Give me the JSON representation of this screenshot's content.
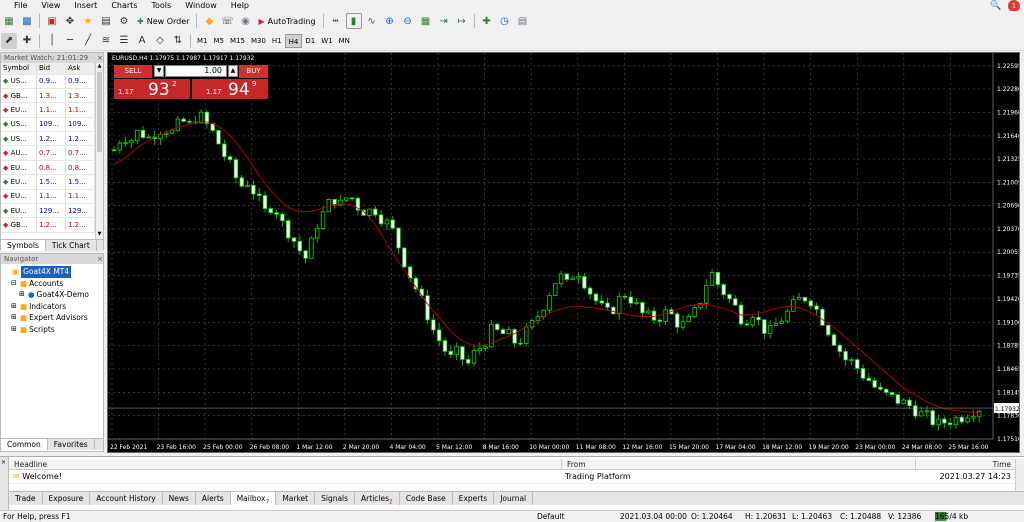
{
  "menu": [
    "File",
    "View",
    "Insert",
    "Charts",
    "Tools",
    "Window",
    "Help"
  ],
  "toolbar": {
    "new_order": "New Order",
    "autotrading": "AutoTrading",
    "timeframes": [
      "M1",
      "M5",
      "M15",
      "M30",
      "H1",
      "H4",
      "D1",
      "W1",
      "MN"
    ],
    "active_tf": "H4",
    "text_tool": "A",
    "notif_count": "1"
  },
  "market_watch": {
    "title": "Market Watch: 21:01:29",
    "cols": [
      "Symbol",
      "Bid",
      "Ask"
    ],
    "rows": [
      {
        "sym": "US...",
        "bid": "0.9...",
        "ask": "0.9...",
        "color": "#0000cc",
        "up": true
      },
      {
        "sym": "GB...",
        "bid": "1.3...",
        "ask": "1.3...",
        "color": "#cc0000",
        "up": false
      },
      {
        "sym": "EU...",
        "bid": "1.1...",
        "ask": "1.1...",
        "color": "#cc0000",
        "up": false
      },
      {
        "sym": "US...",
        "bid": "109...",
        "ask": "109...",
        "color": "#0000cc",
        "up": true
      },
      {
        "sym": "US...",
        "bid": "1.2...",
        "ask": "1.2...",
        "color": "#0000cc",
        "up": true
      },
      {
        "sym": "AU...",
        "bid": "0.7...",
        "ask": "0.7...",
        "color": "#cc0000",
        "up": false
      },
      {
        "sym": "EU...",
        "bid": "0.8...",
        "ask": "0.8...",
        "color": "#cc0000",
        "up": false
      },
      {
        "sym": "EU...",
        "bid": "1.5...",
        "ask": "1.5...",
        "color": "#0000cc",
        "up": true
      },
      {
        "sym": "EU...",
        "bid": "1.1...",
        "ask": "1.1...",
        "color": "#cc0000",
        "up": false
      },
      {
        "sym": "EU...",
        "bid": "129...",
        "ask": "129...",
        "color": "#0000cc",
        "up": true
      },
      {
        "sym": "GB...",
        "bid": "1.2...",
        "ask": "1.2...",
        "color": "#cc0000",
        "up": false
      }
    ],
    "tabs": [
      "Symbols",
      "Tick Chart"
    ]
  },
  "navigator": {
    "title": "Navigator",
    "items": [
      {
        "label": "Goat4X MT4",
        "indent": 0,
        "selected": true,
        "exp": ""
      },
      {
        "label": "Accounts",
        "indent": 1,
        "selected": false,
        "exp": "⊟"
      },
      {
        "label": "Goat4X-Demo",
        "indent": 2,
        "selected": false,
        "exp": "⊞"
      },
      {
        "label": "Indicators",
        "indent": 1,
        "selected": false,
        "exp": "⊞"
      },
      {
        "label": "Expert Advisors",
        "indent": 1,
        "selected": false,
        "exp": "⊞"
      },
      {
        "label": "Scripts",
        "indent": 1,
        "selected": false,
        "exp": "⊞"
      }
    ],
    "tabs": [
      "Common",
      "Favorites"
    ]
  },
  "chart": {
    "header": "EURUSD,H4  1.17975 1.17987 1.17917 1.17932",
    "sell_label": "SELL",
    "buy_label": "BUY",
    "lot": "1.00",
    "sell_prefix": "1.17",
    "sell_big": "93",
    "sell_sup": "2",
    "buy_prefix": "1.17",
    "buy_big": "94",
    "buy_sup": "9",
    "current_price": "1.17932"
  },
  "chart_data": {
    "type": "candlestick",
    "symbol": "EURUSD",
    "timeframe": "H4",
    "ylim": [
      1.1751,
      1.2277
    ],
    "y_ticks": [
      "1.22595",
      "1.22280",
      "1.21960",
      "1.21640",
      "1.21325",
      "1.21005",
      "1.20690",
      "1.20370",
      "1.20055",
      "1.19735",
      "1.19420",
      "1.19100",
      "1.18785",
      "1.18465",
      "1.18145",
      "1.17830",
      "1.17510"
    ],
    "x_ticks": [
      "22 Feb 2021",
      "23 Feb 16:00",
      "25 Feb 00:00",
      "26 Feb 08:00",
      "1 Mar 12:00",
      "2 Mar 20:00",
      "4 Mar 04:00",
      "5 Mar 12:00",
      "8 Mar 16:00",
      "10 Mar 00:00",
      "11 Mar 08:00",
      "12 Mar 16:00",
      "15 Mar 20:00",
      "17 Mar 04:00",
      "18 Mar 12:00",
      "19 Mar 20:00",
      "23 Mar 00:00",
      "24 Mar 08:00",
      "25 Mar 16:00"
    ],
    "close_path": [
      1.2145,
      1.2165,
      1.2158,
      1.2172,
      1.216,
      1.217,
      1.2175,
      1.2168,
      1.2185,
      1.2178,
      1.2195,
      1.218,
      1.2165,
      1.214,
      1.212,
      1.2095,
      1.2102,
      1.208,
      1.206,
      1.2072,
      1.2045,
      1.203,
      1.201,
      1.1995,
      1.204,
      1.206,
      1.208,
      1.207,
      1.2085,
      1.2068,
      1.206,
      1.2065,
      1.205,
      1.204,
      1.201,
      1.198,
      1.1955,
      1.193,
      1.19,
      1.188,
      1.186,
      1.187,
      1.185,
      1.187,
      1.188,
      1.19,
      1.1895,
      1.1892,
      1.188,
      1.1895,
      1.191,
      1.193,
      1.1955,
      1.1975,
      1.196,
      1.1985,
      1.1965,
      1.1945,
      1.193,
      1.192,
      1.194,
      1.195,
      1.1935,
      1.192,
      1.1915,
      1.1918,
      1.1925,
      1.191,
      1.1905,
      1.192,
      1.1945,
      1.198,
      1.196,
      1.1945,
      1.193,
      1.191,
      1.1925,
      1.1905,
      1.1895,
      1.191,
      1.192,
      1.1935,
      1.1945,
      1.194,
      1.192,
      1.19,
      1.188,
      1.186,
      1.1855,
      1.184,
      1.183,
      1.1815,
      1.181,
      1.1805,
      1.18,
      1.1795,
      1.1785,
      1.178,
      1.177,
      1.1775,
      1.1778,
      1.1782,
      1.179,
      1.1793
    ],
    "ma_path": [
      1.2125,
      1.2135,
      1.215,
      1.216,
      1.2168,
      1.2175,
      1.218,
      1.2185,
      1.218,
      1.217,
      1.215,
      1.2125,
      1.21,
      1.208,
      1.2065,
      1.206,
      1.2062,
      1.2068,
      1.2072,
      1.207,
      1.206,
      1.204,
      1.201,
      1.1985,
      1.196,
      1.1935,
      1.1915,
      1.1895,
      1.1882,
      1.1878,
      1.188,
      1.1888,
      1.1895,
      1.1905,
      1.1915,
      1.1925,
      1.193,
      1.1932,
      1.193,
      1.1928,
      1.1924,
      1.192,
      1.1918,
      1.1918,
      1.1922,
      1.1928,
      1.1933,
      1.1935,
      1.1932,
      1.1927,
      1.192,
      1.192,
      1.1925,
      1.193,
      1.1932,
      1.1928,
      1.192,
      1.1908,
      1.1895,
      1.188,
      1.1865,
      1.185,
      1.1835,
      1.182,
      1.181,
      1.18,
      1.1793,
      1.179,
      1.1788,
      1.1787
    ]
  },
  "terminal": {
    "cols": [
      "Headline",
      "From",
      "Time"
    ],
    "rows": [
      {
        "headline": "Welcome!",
        "from": "Trading Platform",
        "time": "2021.03.27 14:23"
      },
      {
        "headline": "",
        "from": "",
        "time": ""
      }
    ],
    "tabs": [
      "Trade",
      "Exposure",
      "Account History",
      "News",
      "Alerts",
      "Mailbox",
      "Market",
      "Signals",
      "Articles",
      "Code Base",
      "Experts",
      "Journal"
    ],
    "active_tab": "Mailbox",
    "mailbox_badge": "7",
    "articles_badge": "2",
    "side_label": "Terminal"
  },
  "status": {
    "help": "For Help, press F1",
    "profile": "Default",
    "time": "2021.03.04 00:00",
    "open": "O: 1.20464",
    "high": "H: 1.20631",
    "low": "L: 1.20463",
    "close": "C: 1.20488",
    "volume": "V: 12386",
    "traffic": "165/4 kb"
  }
}
